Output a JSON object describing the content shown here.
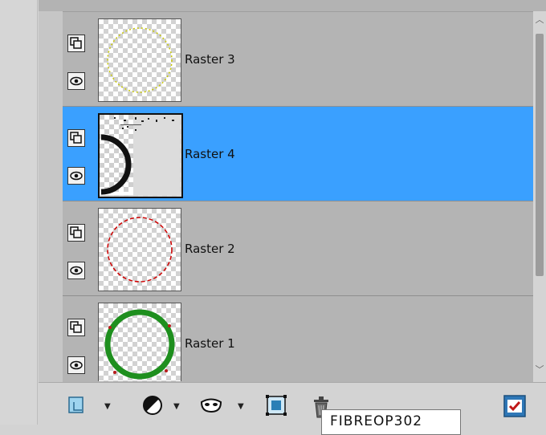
{
  "layers": [
    {
      "name": "Raster 3",
      "selected": false,
      "ring_color": "#c8c800",
      "ring_style": "dotted"
    },
    {
      "name": "Raster 4",
      "selected": true
    },
    {
      "name": "Raster 2",
      "selected": false,
      "ring_color": "#d00000",
      "ring_style": "dashed"
    },
    {
      "name": "Raster 1",
      "selected": false,
      "ring_color": "#1e8f1e",
      "ring_style": "solid"
    }
  ],
  "colors": {
    "selection": "#3aa0ff",
    "panel": "#b4b4b4"
  },
  "toolbar": {
    "icons": [
      "new-layer-icon",
      "adjustment-layer-icon",
      "mask-icon",
      "group-icon",
      "delete-icon",
      "properties-icon"
    ]
  },
  "tooltip": {
    "text": "FIBREOP302"
  }
}
